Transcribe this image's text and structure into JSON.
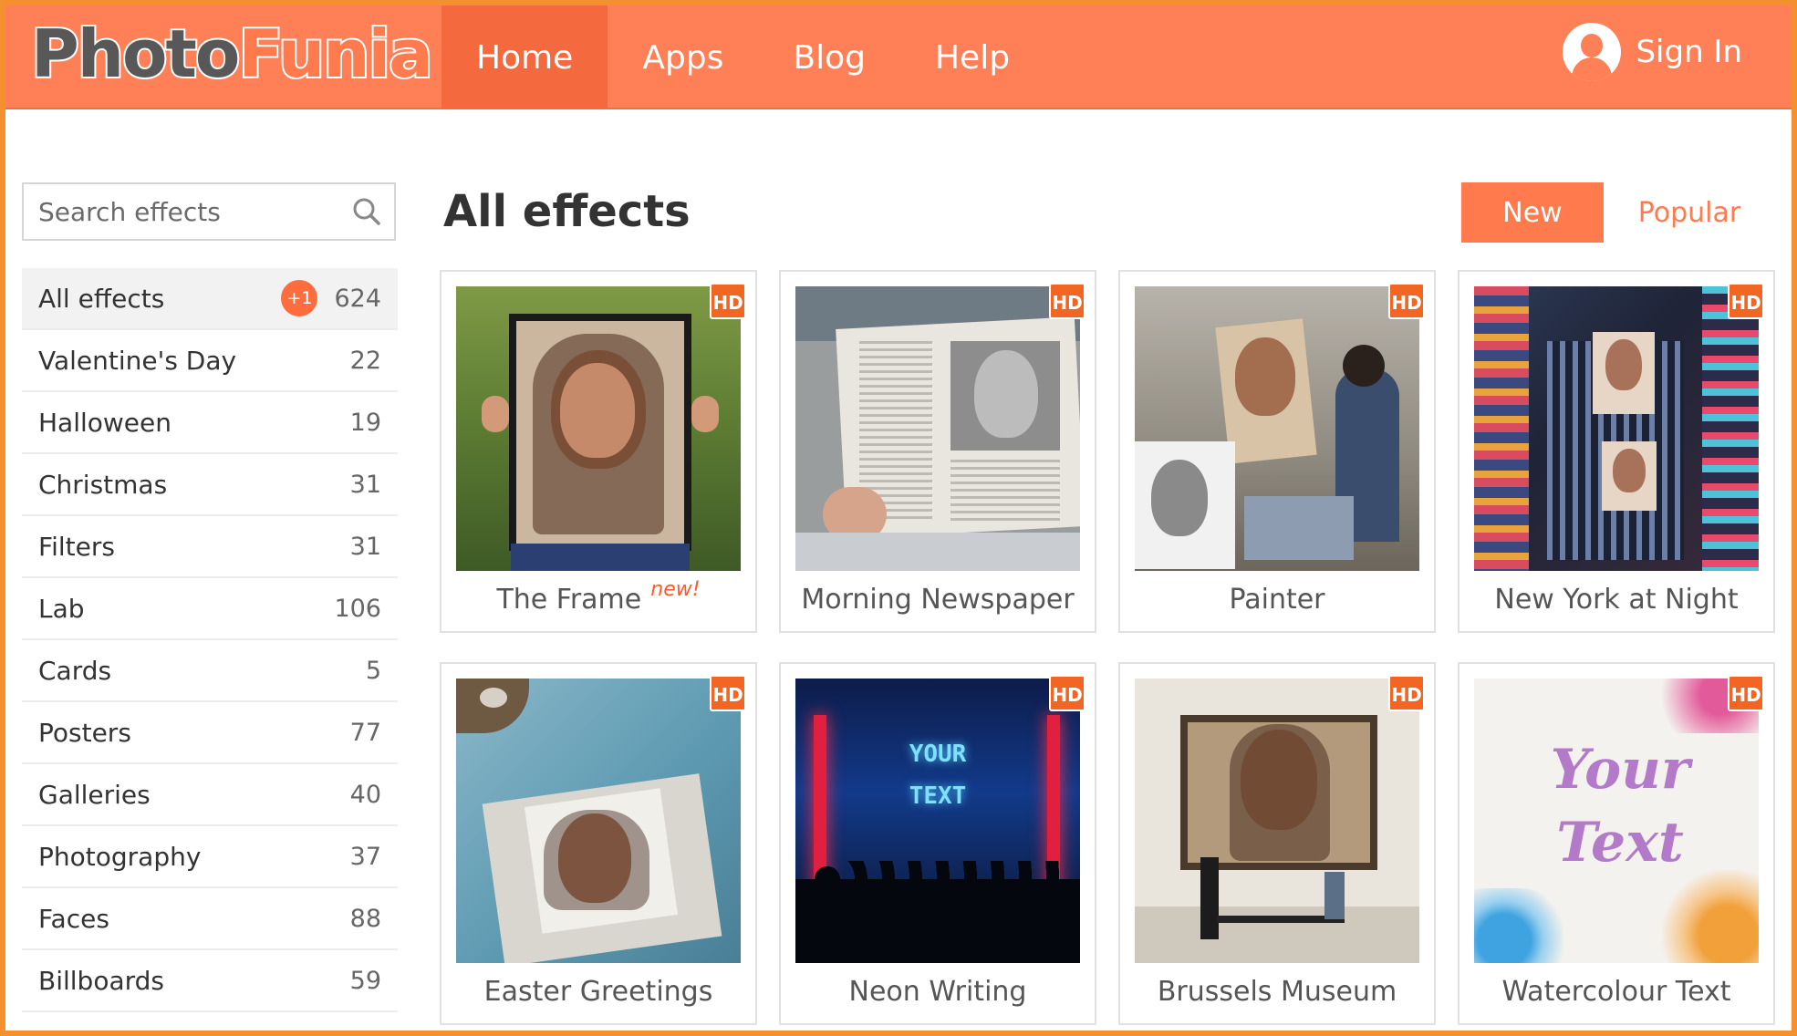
{
  "header": {
    "logo_part1": "Photo",
    "logo_part2": "Funia",
    "nav": [
      "Home",
      "Apps",
      "Blog",
      "Help"
    ],
    "active_nav": "Home",
    "sign_in": "Sign In"
  },
  "sidebar": {
    "search_placeholder": "Search effects",
    "categories": [
      {
        "label": "All effects",
        "badge": "+1",
        "count": "624"
      },
      {
        "label": "Valentine's Day",
        "count": "22"
      },
      {
        "label": "Halloween",
        "count": "19"
      },
      {
        "label": "Christmas",
        "count": "31"
      },
      {
        "label": "Filters",
        "count": "31"
      },
      {
        "label": "Lab",
        "count": "106"
      },
      {
        "label": "Cards",
        "count": "5"
      },
      {
        "label": "Posters",
        "count": "77"
      },
      {
        "label": "Galleries",
        "count": "40"
      },
      {
        "label": "Photography",
        "count": "37"
      },
      {
        "label": "Faces",
        "count": "88"
      },
      {
        "label": "Billboards",
        "count": "59"
      }
    ]
  },
  "main": {
    "title": "All effects",
    "sort_new": "New",
    "sort_popular": "Popular",
    "effects": [
      {
        "title": "The Frame",
        "hd": "HD",
        "tag": "new!"
      },
      {
        "title": "Morning Newspaper",
        "hd": "HD"
      },
      {
        "title": "Painter",
        "hd": "HD"
      },
      {
        "title": "New York at Night",
        "hd": "HD"
      },
      {
        "title": "Easter Greetings",
        "hd": "HD"
      },
      {
        "title": "Neon Writing",
        "hd": "HD",
        "thumb_text": "YOUR TEXT"
      },
      {
        "title": "Brussels Museum",
        "hd": "HD"
      },
      {
        "title": "Watercolour Text",
        "hd": "HD",
        "thumb_text": "Your Text"
      }
    ]
  },
  "colors": {
    "brand": "#ff7f57",
    "accent": "#ff7a4c",
    "badge": "#f26522"
  }
}
